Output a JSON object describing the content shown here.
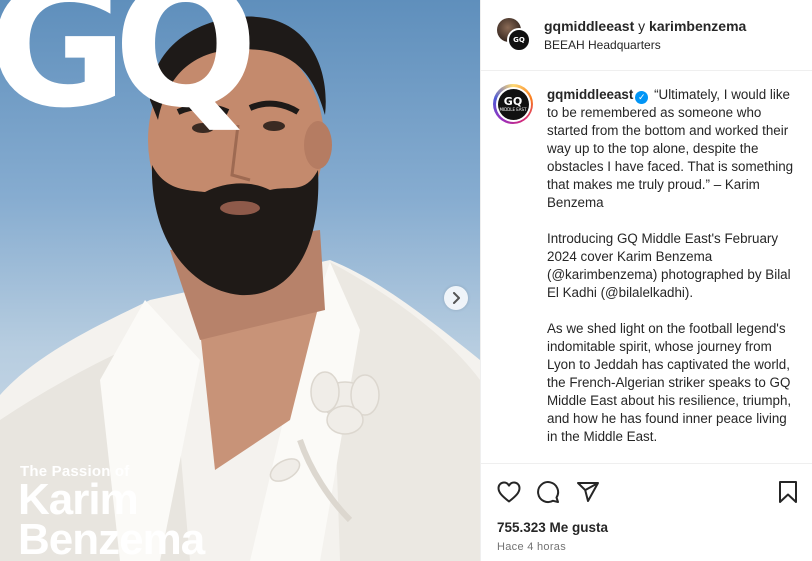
{
  "media": {
    "masthead": "GQ",
    "cover_kicker": "The Passion of",
    "cover_name_line1": "Karim",
    "cover_name_line2": "Benzema",
    "next_icon": "chevron-right-icon"
  },
  "header": {
    "account_primary": "gqmiddleeast",
    "connector": "y",
    "account_secondary": "karimbenzema",
    "location": "BEEAH Headquarters",
    "avatar_badge": "GQ"
  },
  "caption": {
    "username": "gqmiddleeast",
    "verified_icon": "verified-badge-icon",
    "avatar_logo": "GQ",
    "avatar_sub": "MIDDLE EAST",
    "paragraph1": "“Ultimately, I would like to be remembered as someone who started from the bottom and worked their way up to the top alone, despite the obstacles I have faced. That is something that makes me truly proud.” – Karim Benzema",
    "paragraph2": "Introducing GQ Middle East's February 2024 cover Karim Benzema (@karimbenzema) photographed by Bilal El Kadhi (@bilalelkadhi).",
    "paragraph3": "As we shed light on the football legend's indomitable spirit, whose journey from Lyon to Jeddah has captivated the world, the French-Algerian striker speaks to GQ Middle East about his resilience, triumph, and how he has found inner peace living in the Middle East."
  },
  "actions": {
    "icons": [
      "heart-icon",
      "comment-icon",
      "share-icon",
      "bookmark-icon"
    ],
    "likes": "755.323 Me gusta",
    "time": "Hace 4 horas"
  },
  "colors": {
    "text": "#262626",
    "muted": "#737373",
    "verified": "#0095f6",
    "border": "#efefef"
  }
}
